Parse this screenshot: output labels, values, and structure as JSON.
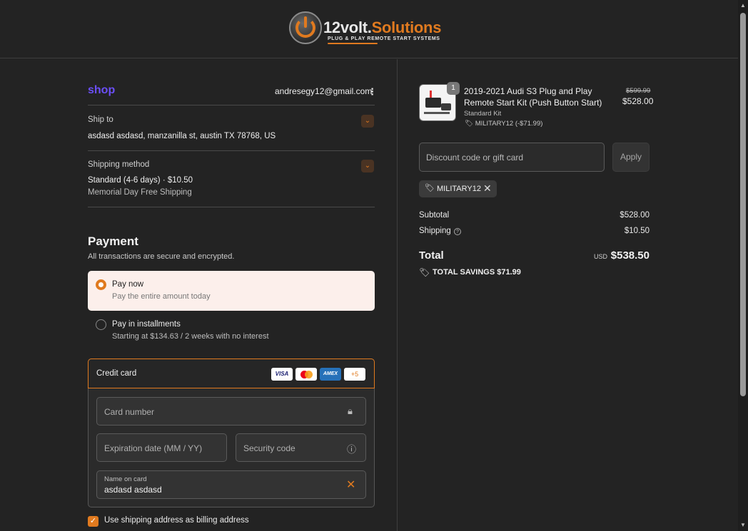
{
  "header": {
    "logo_text_prefix": "12",
    "logo_text_main": "volt.",
    "logo_text_suffix": "Solutions",
    "logo_tagline": "PLUG & PLAY REMOTE START SYSTEMS"
  },
  "account": {
    "shop_label": "shop",
    "email": "andresegy12@gmail.com",
    "menu_icon": "kebab-menu-icon"
  },
  "ship_to": {
    "label": "Ship to",
    "address": "asdasd asdasd, manzanilla st, austin TX 78768, US"
  },
  "shipping_method": {
    "label": "Shipping method",
    "value": "Standard (4-6 days) · $10.50",
    "note": "Memorial Day Free Shipping"
  },
  "payment": {
    "title": "Payment",
    "subtitle": "All transactions are secure and encrypted.",
    "options": [
      {
        "title": "Pay now",
        "subtitle": "Pay the entire amount today",
        "selected": true
      },
      {
        "title": "Pay in installments",
        "subtitle": "Starting at $134.63 / 2 weeks with no interest",
        "selected": false
      }
    ],
    "credit_card": {
      "label": "Credit card",
      "brands": [
        "VISA",
        "Mastercard",
        "AMEX"
      ],
      "more": "+5",
      "card_number_placeholder": "Card number",
      "expiration_placeholder": "Expiration date (MM / YY)",
      "security_placeholder": "Security code",
      "name_label": "Name on card",
      "name_value": "asdasd asdasd"
    },
    "billing_checkbox_label": "Use shipping address as billing address",
    "billing_checked": true
  },
  "order": {
    "item": {
      "quantity": "1",
      "name": "2019-2021 Audi S3 Plug and Play Remote Start Kit (Push Button Start)",
      "variant": "Standard Kit",
      "discount": "MILITARY12 (-$71.99)",
      "original_price": "$599.99",
      "price": "$528.00"
    },
    "discount_placeholder": "Discount code or gift card",
    "apply_label": "Apply",
    "applied_code": "MILITARY12",
    "subtotal_label": "Subtotal",
    "subtotal": "$528.00",
    "shipping_label": "Shipping",
    "shipping": "$10.50",
    "total_label": "Total",
    "currency": "USD",
    "total": "$538.50",
    "savings": "TOTAL SAVINGS  $71.99"
  },
  "colors": {
    "accent": "#e07a1f",
    "shop_purple": "#6b4ff7",
    "background": "#232323"
  }
}
